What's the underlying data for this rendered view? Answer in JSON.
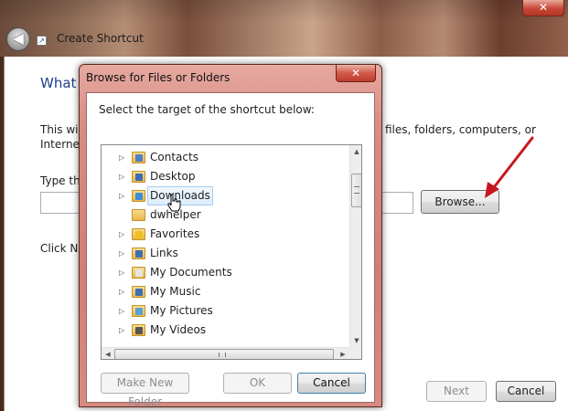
{
  "window": {
    "title": "Create Shortcut",
    "close_glyph": "✕",
    "back_glyph": "◀"
  },
  "wizard": {
    "heading": "What",
    "description_left_line1": "This wiz",
    "description_left_line2": "Internet",
    "description_right": "files, folders, computers, or",
    "type_label": "Type the",
    "location_value": "",
    "browse_label": "Browse...",
    "click_next": "Click Ne",
    "next_label": "Next",
    "cancel_label": "Cancel"
  },
  "dialog": {
    "title": "Browse for Files or Folders",
    "close_glyph": "✕",
    "instruction": "Select the target of the shortcut below:",
    "tree_items": [
      {
        "label": "Contacts",
        "has_children": true,
        "badge": "#4f7fc6"
      },
      {
        "label": "Desktop",
        "has_children": true,
        "badge": "#3a6db5"
      },
      {
        "label": "Downloads",
        "has_children": true,
        "badge": "#3a8fd8",
        "hover": true
      },
      {
        "label": "dwhelper",
        "has_children": false,
        "badge": ""
      },
      {
        "label": "Favorites",
        "has_children": true,
        "badge": "#f0c020"
      },
      {
        "label": "Links",
        "has_children": true,
        "badge": "#3c6fb8"
      },
      {
        "label": "My Documents",
        "has_children": true,
        "badge": "#e6e6e6"
      },
      {
        "label": "My Music",
        "has_children": true,
        "badge": "#3c6fb8"
      },
      {
        "label": "My Pictures",
        "has_children": true,
        "badge": "#59a0d8"
      },
      {
        "label": "My Videos",
        "has_children": true,
        "badge": "#555555"
      }
    ],
    "make_new_folder_label": "Make New Folder",
    "ok_label": "OK",
    "cancel_label": "Cancel"
  },
  "colors": {
    "annotation_arrow": "#c8161d",
    "heading_blue": "#1e3f8a"
  }
}
